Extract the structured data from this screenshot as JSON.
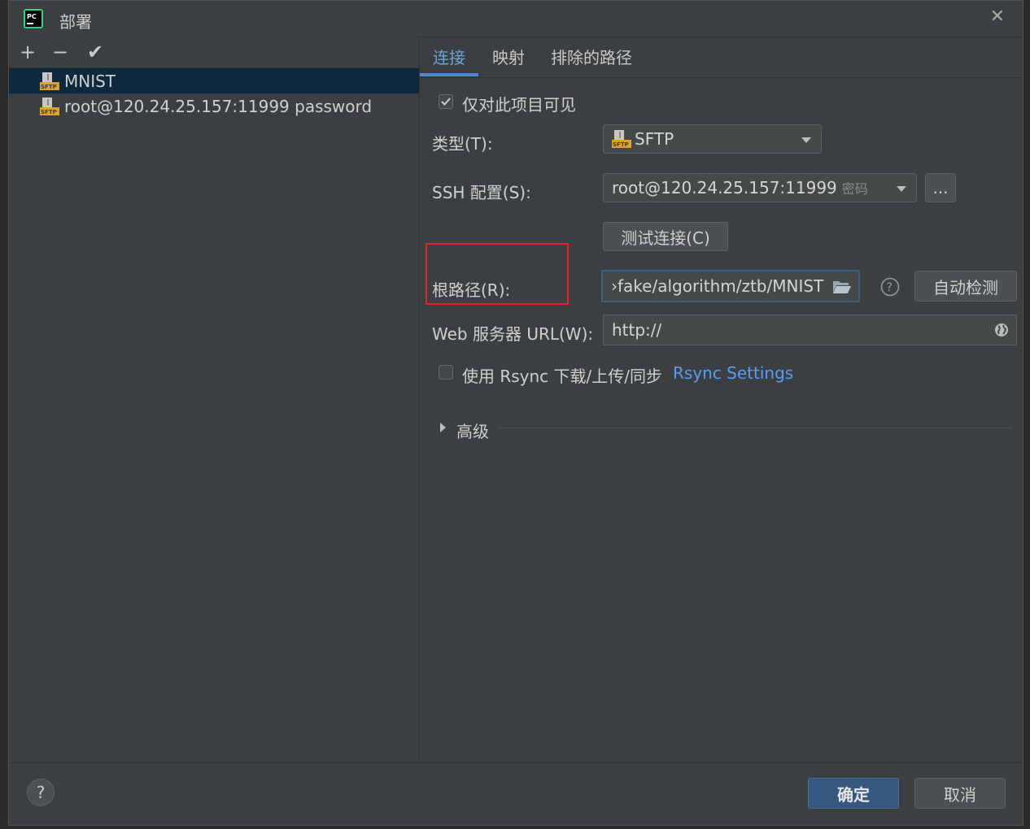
{
  "window": {
    "title": "部署"
  },
  "toolbar": {
    "add": "+",
    "remove": "−",
    "apply": "✔"
  },
  "servers": [
    {
      "label": "MNIST",
      "icon": "sftp-icon",
      "selected": true
    },
    {
      "label": "root@120.24.25.157:11999 password",
      "icon": "sftp-icon",
      "selected": false
    }
  ],
  "tabs": [
    {
      "label": "连接",
      "active": true
    },
    {
      "label": "映射",
      "active": false
    },
    {
      "label": "排除的路径",
      "active": false
    }
  ],
  "form": {
    "visible_only_label": "仅对此项目可见",
    "visible_only_checked": true,
    "type_label": "类型(T):",
    "type_value": "SFTP",
    "ssh_label": "SSH 配置(S):",
    "ssh_value": "root@120.24.25.157:11999",
    "ssh_value_suffix": "密码",
    "ssh_more": "...",
    "test_button": "测试连接(C)",
    "root_label": "根路径(R):",
    "root_value": "›fake/algorithm/ztb/MNIST",
    "autodetect_button": "自动检测",
    "web_label": "Web 服务器 URL(W):",
    "web_value": "http://",
    "rsync_label": "使用 Rsync 下载/上传/同步",
    "rsync_checked": false,
    "rsync_link": "Rsync Settings",
    "advanced_label": "高级"
  },
  "footer": {
    "help": "?",
    "ok": "确定",
    "cancel": "取消"
  },
  "colors": {
    "accent": "#4a88c7",
    "link": "#589df6",
    "highlight": "#e4242c",
    "selection": "#0d293e"
  }
}
